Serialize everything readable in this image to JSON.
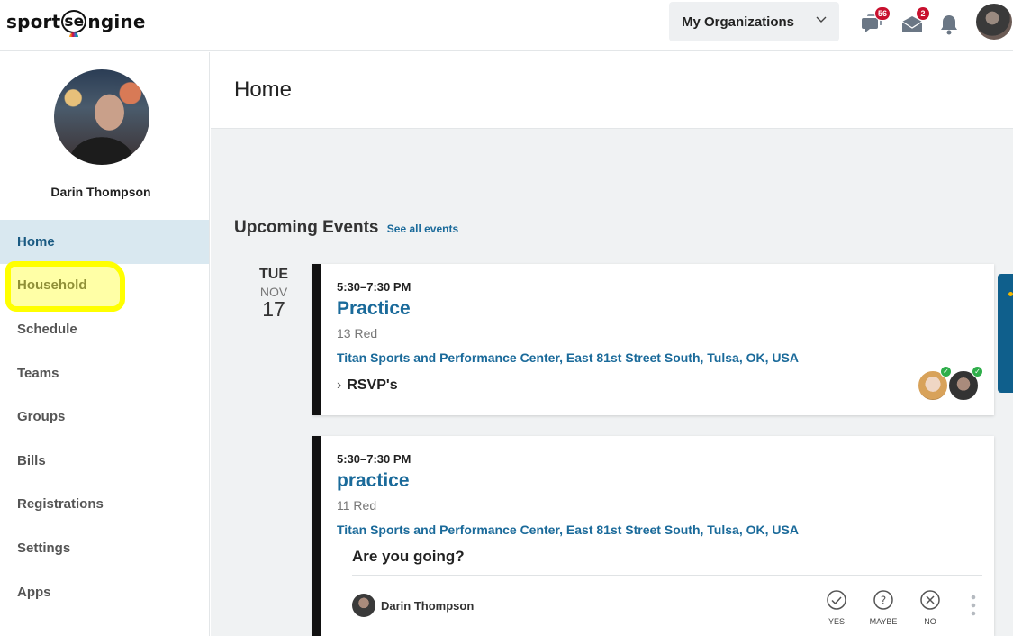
{
  "header": {
    "logo_left": "sport",
    "logo_mid": "se",
    "logo_right": "ngine",
    "org_label": "My Organizations",
    "chat_count": "56",
    "mail_count": "2"
  },
  "sidebar": {
    "user_name": "Darin Thompson",
    "items": [
      {
        "label": "Home"
      },
      {
        "label": "Household"
      },
      {
        "label": "Schedule"
      },
      {
        "label": "Teams"
      },
      {
        "label": "Groups"
      },
      {
        "label": "Bills"
      },
      {
        "label": "Registrations"
      },
      {
        "label": "Settings"
      },
      {
        "label": "Apps"
      }
    ]
  },
  "main": {
    "title": "Home",
    "events_heading": "Upcoming Events",
    "see_all": "See all events",
    "date": {
      "dow": "TUE",
      "month": "NOV",
      "day": "17"
    },
    "events": [
      {
        "time": "5:30–7:30 PM",
        "title": "Practice",
        "team": "13 Red",
        "location": "Titan Sports and Performance Center, East 81st Street South, Tulsa, OK, USA",
        "rsvp_label": "RSVP's"
      },
      {
        "time": "5:30–7:30 PM",
        "title": "practice",
        "team": "11 Red",
        "location": "Titan Sports and Performance Center, East 81st Street South, Tulsa, OK, USA",
        "question": "Are you going?",
        "responder": "Darin Thompson",
        "options": {
          "yes": "YES",
          "maybe": "MAYBE",
          "no": "NO"
        }
      }
    ]
  },
  "colors": {
    "accent": "#1a6a9a",
    "active_nav_bg": "#d9e8f0",
    "badge": "#c8102e",
    "highlight": "#ffff00"
  }
}
